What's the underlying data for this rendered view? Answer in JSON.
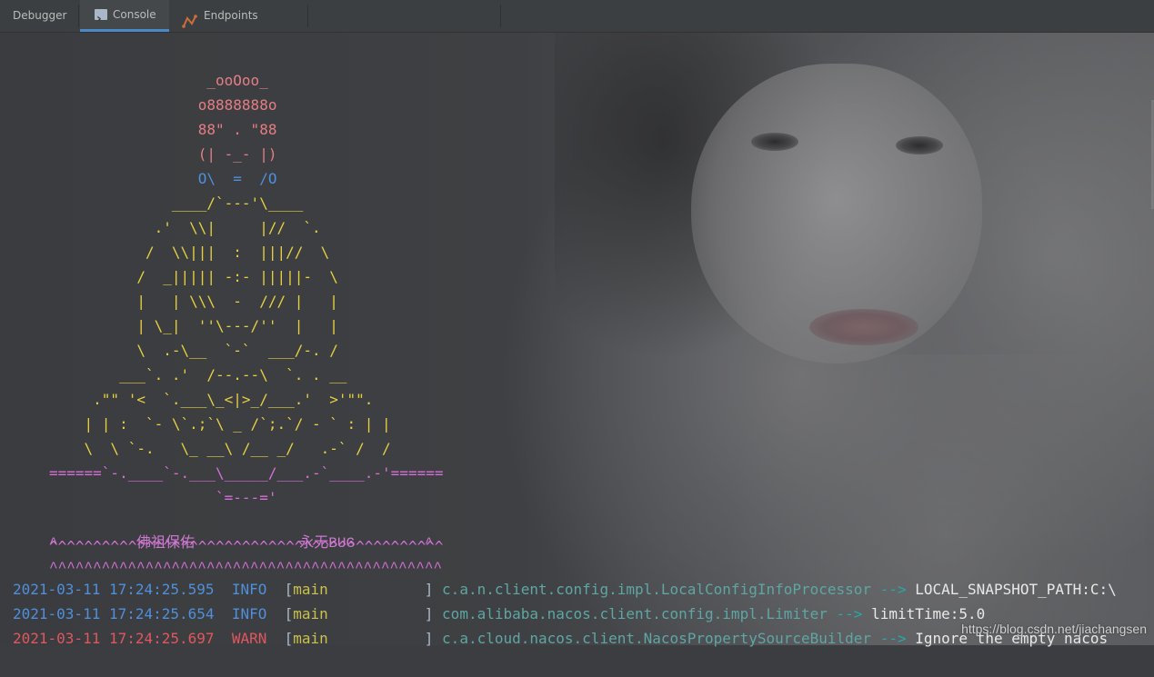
{
  "toolbar": {
    "tabs": [
      {
        "label": "Debugger",
        "icon": "none"
      },
      {
        "label": "Console",
        "icon": "console-icon",
        "active": true
      },
      {
        "label": "Endpoints",
        "icon": "endpoints-icon"
      }
    ]
  },
  "ascii_art": {
    "lines": [
      {
        "text": "                  _ooOoo_",
        "color": "pink"
      },
      {
        "text": "                 o8888888o",
        "color": "pink"
      },
      {
        "text": "                 88\" . \"88",
        "color": "pink"
      },
      {
        "text": "                 (| -_- |)",
        "color": "pink"
      },
      {
        "text": "                 O\\  =  /O",
        "color": "blue"
      },
      {
        "text": "              ____/`---'\\____",
        "color": "yellow"
      },
      {
        "text": "            .'  \\\\|     |//  `.",
        "color": "yellow"
      },
      {
        "text": "           /  \\\\|||  :  |||//  \\",
        "color": "yellow"
      },
      {
        "text": "          /  _||||| -:- |||||-  \\",
        "color": "yellow"
      },
      {
        "text": "          |   | \\\\\\  -  /// |   |",
        "color": "yellow"
      },
      {
        "text": "          | \\_|  ''\\---/''  |   |",
        "color": "yellow"
      },
      {
        "text": "          \\  .-\\__  `-`  ___/-. /",
        "color": "yellow"
      },
      {
        "text": "        ___`. .'  /--.--\\  `. . __",
        "color": "yellow"
      },
      {
        "text": "     .\"\" '<  `.___\\_<|>_/___.'  >'\"\".",
        "color": "yellow"
      },
      {
        "text": "    | | :  `- \\`.;`\\ _ /`;.`/ - ` : | |",
        "color": "yellow"
      },
      {
        "text": "    \\  \\ `-.   \\_ __\\ /__ _/   .-` /  /",
        "color": "yellow"
      },
      {
        "text": "======`-.____`-.___\\_____/___.-`____.-'======",
        "color": "magenta"
      },
      {
        "text": "                   `=---='",
        "color": "magenta"
      },
      {
        "text": "",
        "color": "magenta"
      },
      {
        "text": "^^^^^^^^^^^^^^^^^^^^^^^^^^^^^^^^^^^^^^^^^^^^^",
        "color": "magenta"
      }
    ],
    "blessing_line": {
      "caret_left": "^",
      "text_left": "佛祖保佑",
      "text_right": "永无BUG",
      "caret_right": "^"
    },
    "bottom_line": "^^^^^^^^^^^^^^^^^^^^^^^^^^^^^^^^^^^^^^^^^^^^^"
  },
  "logs": [
    {
      "timestamp": "2021-03-11 17:24:25.595",
      "level": "INFO",
      "thread": "main",
      "logger": "c.a.n.client.config.impl.LocalConfigInfoProcessor",
      "arrow": "-->",
      "message": "LOCAL_SNAPSHOT_PATH:C:\\"
    },
    {
      "timestamp": "2021-03-11 17:24:25.654",
      "level": "INFO",
      "thread": "main",
      "logger": "com.alibaba.nacos.client.config.impl.Limiter",
      "arrow": "-->",
      "message": "limitTime:5.0"
    },
    {
      "timestamp": "2021-03-11 17:24:25.697",
      "level": "WARN",
      "thread": "main",
      "logger": "c.a.cloud.nacos.client.NacosPropertySourceBuilder",
      "arrow": "-->",
      "message": "Ignore the empty nacos"
    }
  ],
  "watermark": "https://blog.csdn.net/jiachangsen",
  "colors": {
    "pink": "#e57e84",
    "blue": "#4f8fdb",
    "yellow": "#e6d040",
    "magenta": "#d66fd8",
    "warn": "#e0575e",
    "logger": "#5ea6a3",
    "accent": "#4a88c7"
  }
}
